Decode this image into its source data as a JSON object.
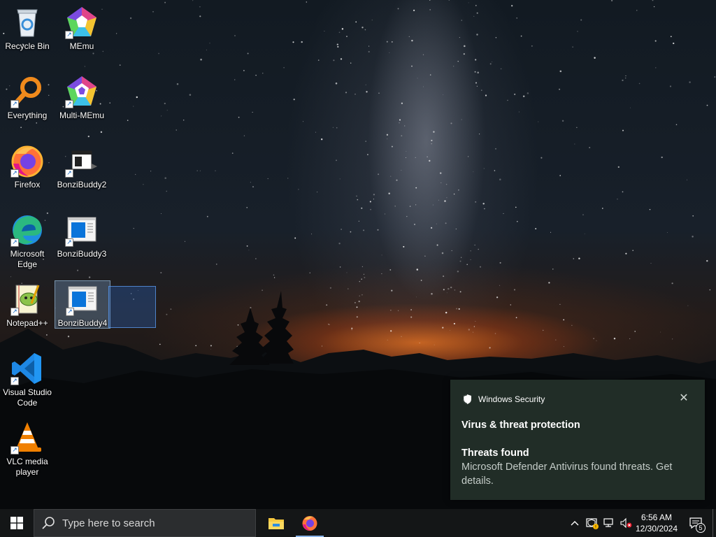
{
  "desktop": {
    "icons": [
      {
        "label": "Recycle Bin",
        "icon": "recycle-bin-icon"
      },
      {
        "label": "MEmu",
        "icon": "memu-icon"
      },
      {
        "label": "Everything",
        "icon": "everything-search-icon"
      },
      {
        "label": "Multi-MEmu",
        "icon": "multi-memu-icon"
      },
      {
        "label": "Firefox",
        "icon": "firefox-icon"
      },
      {
        "label": "BonziBuddy2",
        "icon": "bonzibuddy-icon"
      },
      {
        "label": "Microsoft Edge",
        "icon": "edge-icon"
      },
      {
        "label": "BonziBuddy3",
        "icon": "bonzibuddy-window-icon"
      },
      {
        "label": "Notepad++",
        "icon": "notepadpp-icon"
      },
      {
        "label": "BonziBuddy4",
        "icon": "bonzibuddy-window-icon"
      },
      {
        "label": "Visual Studio Code",
        "icon": "vscode-icon"
      },
      {
        "label": "VLC media player",
        "icon": "vlc-icon"
      }
    ],
    "selected_icon": "BonziBuddy4"
  },
  "notification": {
    "app_name": "Windows Security",
    "title": "Virus & threat protection",
    "subtitle": "Threats found",
    "body": "Microsoft Defender Antivirus found threats. Get details.",
    "close_symbol": "✕"
  },
  "taskbar": {
    "search_placeholder": "Type here to search",
    "pinned_apps": [
      "file-explorer-icon",
      "firefox-icon"
    ],
    "active_app": "Firefox",
    "tray_icons": [
      "chevron-up-icon",
      "windows-security-warning-icon",
      "network-icon",
      "volume-muted-icon"
    ],
    "time": "6:56 AM",
    "date": "12/30/2024",
    "notification_count": "5"
  },
  "colors": {
    "accent": "#8ab4e8",
    "taskbar": "#141617",
    "toast_bg": "#24302a",
    "warning": "#f5b400",
    "error": "#e81123"
  }
}
